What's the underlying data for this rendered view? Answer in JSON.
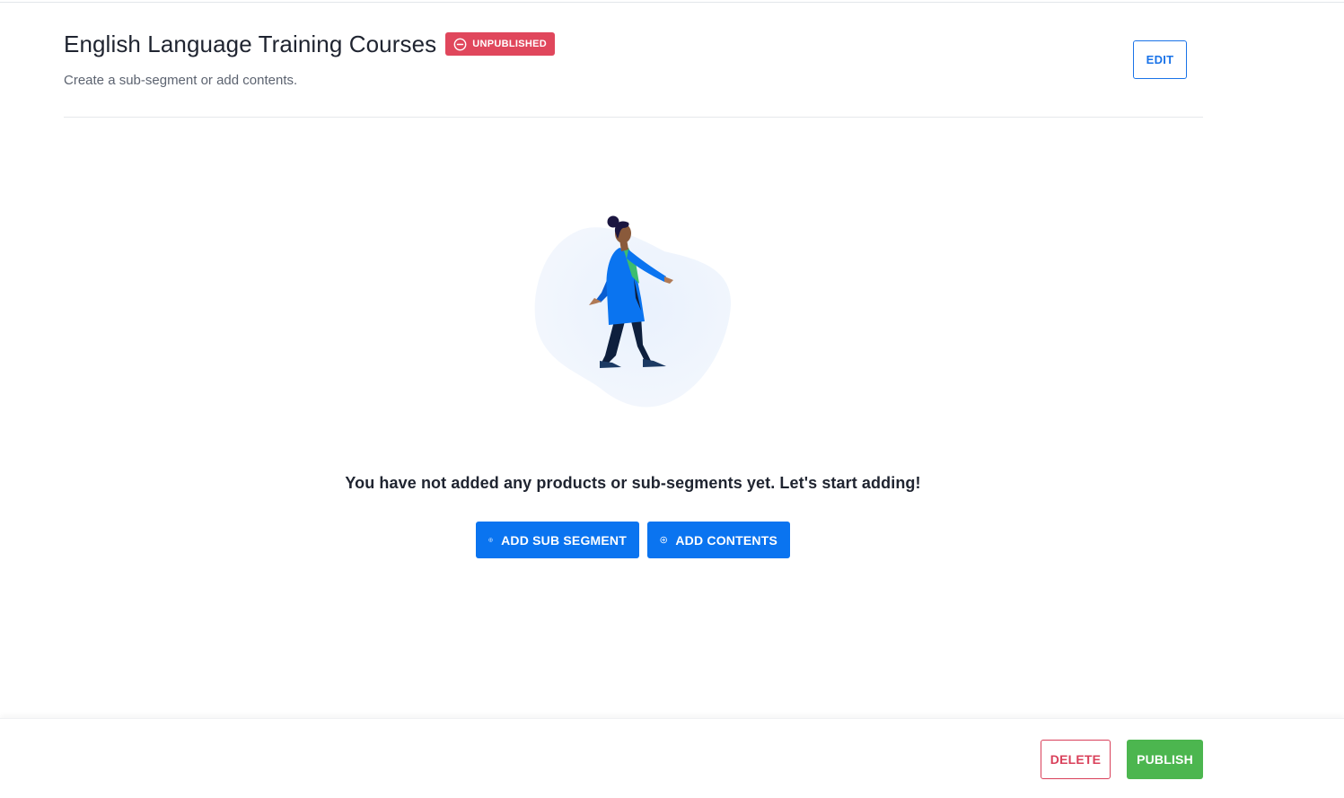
{
  "header": {
    "title": "English Language Training Courses",
    "status": "UNPUBLISHED",
    "subtitle": "Create a sub-segment or add contents.",
    "edit_label": "EDIT"
  },
  "empty_state": {
    "message": "You have not added any products or sub-segments yet. Let's start adding!",
    "illustration": "walking-person-icon",
    "add_sub_segment_label": "ADD SUB SEGMENT",
    "add_contents_label": "ADD CONTENTS"
  },
  "footer": {
    "delete_label": "DELETE",
    "publish_label": "PUBLISH"
  },
  "colors": {
    "primary": "#0a74f0",
    "danger": "#e0475c",
    "success": "#4cb64f"
  },
  "icons": {
    "status": "minus-circle-icon",
    "add": "plus-circle-icon"
  }
}
